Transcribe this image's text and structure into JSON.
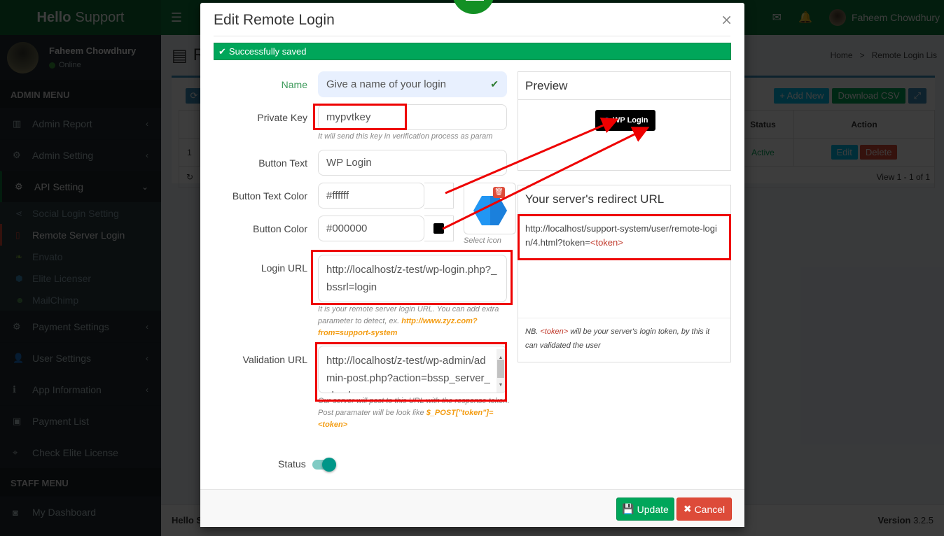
{
  "app": {
    "logo_bold": "Hello",
    "logo_rest": "Support",
    "header_user": "Faheem Chowdhury",
    "footer_left": "Hello S",
    "footer_version_label": "Version",
    "footer_version": "3.2.5"
  },
  "sidebar": {
    "user_name": "Faheem Chowdhury",
    "user_status": "Online",
    "admin_header": "ADMIN MENU",
    "items": [
      {
        "label": "Admin Report",
        "icon": "bar-chart-icon"
      },
      {
        "label": "Admin Setting",
        "icon": "users-cog-icon"
      },
      {
        "label": "API Setting",
        "icon": "gear-icon"
      }
    ],
    "api_sub_items": [
      {
        "label": "Social Login Setting",
        "icon": "share-icon"
      },
      {
        "label": "Remote Server Login",
        "icon": "id-badge-icon"
      },
      {
        "label": "Envato",
        "icon": "leaf-icon"
      },
      {
        "label": "Elite Licenser",
        "icon": "hexagon-icon"
      },
      {
        "label": "MailChimp",
        "icon": "mailchimp-icon"
      }
    ],
    "items_after": [
      {
        "label": "Payment Settings",
        "icon": "gear-icon"
      },
      {
        "label": "User Settings",
        "icon": "user-icon"
      },
      {
        "label": "App Information",
        "icon": "info-icon"
      },
      {
        "label": "Payment List",
        "icon": "money-icon"
      },
      {
        "label": "Check Elite License",
        "icon": "crosshair-icon"
      }
    ],
    "staff_header": "STAFF MENU",
    "staff_items": [
      {
        "label": "My Dashboard",
        "icon": "camera-icon"
      }
    ]
  },
  "page": {
    "title_initial": "R",
    "breadcrumb": [
      "Home",
      ">",
      "Remote Login Lis"
    ],
    "tools": {
      "add_new": "+ Add New",
      "download_csv": "Download CSV"
    },
    "grid": {
      "headers": [
        "",
        "",
        "Status",
        "Action"
      ],
      "rows": [
        {
          "num": "1",
          "status": "Active",
          "edit": "Edit",
          "delete": "Delete"
        }
      ],
      "footer": "View 1 - 1 of 1"
    }
  },
  "modal": {
    "title": "Edit Remote Login",
    "close": "×",
    "alert": "Successfully saved",
    "fields": {
      "name": {
        "label": "Name",
        "value": "Give a name of your login"
      },
      "private_key": {
        "label": "Private Key",
        "value": "mypvtkey",
        "help": "It will send this key in verification process as param"
      },
      "button_text": {
        "label": "Button Text",
        "value": "WP Login"
      },
      "button_text_color": {
        "label": "Button Text Color",
        "value": "#ffffff",
        "swatch": "#ffffff"
      },
      "button_color": {
        "label": "Button Color",
        "value": "#000000",
        "swatch": "#000000"
      },
      "select_icon": "Select icon",
      "login_url": {
        "label": "Login URL",
        "value": "http://localhost/z-test/wp-login.php?_bssrl=login",
        "help_text": "It is your remote server login URL. You can add extra parameter to detect, ex. ",
        "help_highlight": "http://www.zyz.com?from=support-system"
      },
      "validation_url": {
        "label": "Validation URL",
        "value": "http://localhost/z-test/wp-admin/admin-post.php?action=bssp_server_check",
        "help_text": "Our server will post to this URL with the response token.",
        "help_text2": "Post paramater will be look like ",
        "help_highlight": "$_POST[\"token\"]=<token>"
      },
      "status": {
        "label": "Status",
        "enabled": true
      }
    },
    "preview": {
      "heading": "Preview",
      "button_label": "WP Login"
    },
    "redirect": {
      "heading": "Your server's redirect URL",
      "url": "http://localhost/support-system/user/remote-login/4.html?token=",
      "token": "<token>",
      "nb_prefix": "NB. ",
      "nb_token": "<token>",
      "nb_text": " will be your server's login token, by this it can validated the user"
    },
    "buttons": {
      "update": "Update",
      "cancel": "Cancel"
    }
  },
  "colors": {
    "brand": "#0f7a3a",
    "success": "#00a65a",
    "danger": "#dd4b39",
    "annotation": "#ee0000",
    "toggle": "#009688"
  }
}
